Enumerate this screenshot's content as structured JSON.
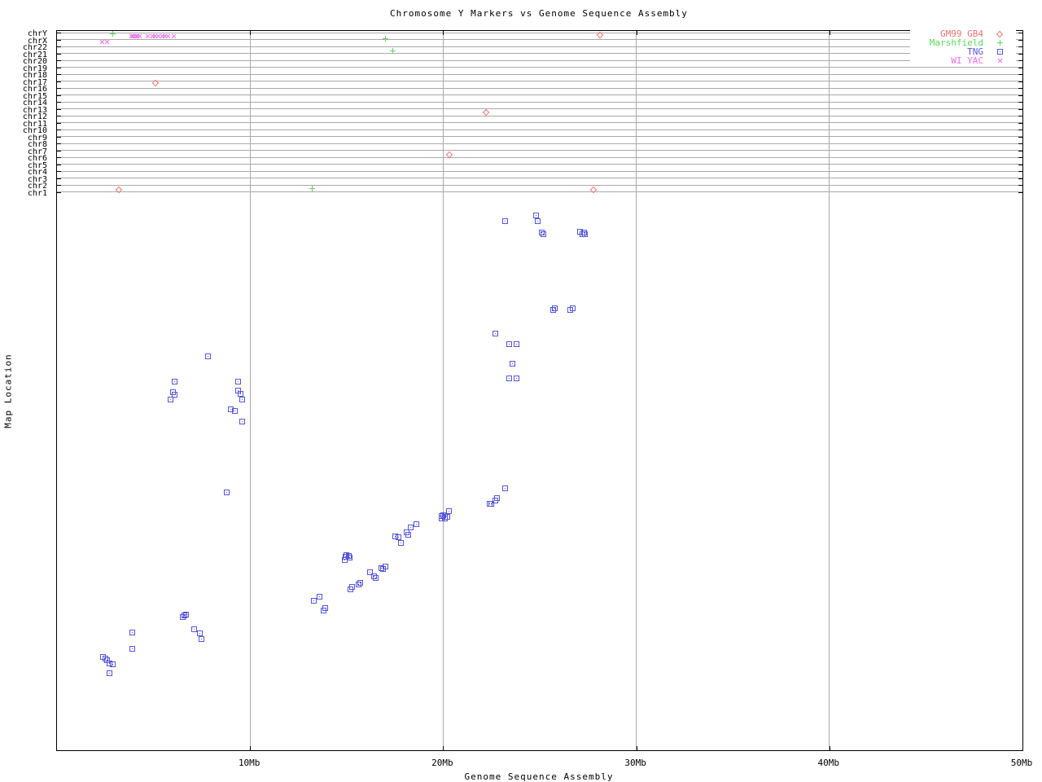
{
  "title": "Chromosome Y Markers vs Genome Sequence Assembly",
  "x_axis": {
    "label": "Genome Sequence Assembly"
  },
  "y_axis": {
    "label": "Map Location"
  },
  "legend": {
    "position": "top-right-inside"
  },
  "chart_data": {
    "type": "scatter",
    "title": "Chromosome Y Markers vs Genome Sequence Assembly",
    "xlabel": "Genome Sequence Assembly",
    "ylabel": "Map Location",
    "x_unit": "Mb",
    "xlim": [
      0,
      50
    ],
    "grid": true,
    "x_ticks": [
      {
        "mb": 10,
        "label": "10Mb"
      },
      {
        "mb": 20,
        "label": "20Mb"
      },
      {
        "mb": 30,
        "label": "30Mb"
      },
      {
        "mb": 40,
        "label": "40Mb"
      },
      {
        "mb": 50,
        "label": "50Mb"
      }
    ],
    "y_rows": [
      "chrY",
      "chrX",
      "chr22",
      "chr21",
      "chr20",
      "chr19",
      "chr18",
      "chr17",
      "chr16",
      "chr15",
      "chr14",
      "chr13",
      "chr12",
      "chr11",
      "chr10",
      "chr9",
      "chr8",
      "chr7",
      "chr6",
      "chr5",
      "chr4",
      "chr3",
      "chr2",
      "chr1"
    ],
    "y_scale_note": "Upper rows are chromosome bins; lower panel is an unlabeled continuous map-location scale. fy = fraction of plot height measured from the top border.",
    "series": [
      {
        "id": "gm99-gb4",
        "name": "GM99 GB4",
        "marker": "diamond",
        "color": "#e87272",
        "points": [
          {
            "chr": "chrY",
            "x": 28.1,
            "fy": 0.0057
          },
          {
            "chr": "chr17",
            "x": 5.1,
            "fy": 0.0725
          },
          {
            "chr": "chr13",
            "x": 22.2,
            "fy": 0.1132
          },
          {
            "chr": "chr7",
            "x": 20.3,
            "fy": 0.1721
          },
          {
            "chr": "chr2",
            "x": 3.2,
            "fy": 0.2208
          },
          {
            "chr": "chr2",
            "x": 27.8,
            "fy": 0.2208
          }
        ]
      },
      {
        "id": "marshfield",
        "name": "Marshfield",
        "marker": "plus",
        "color": "#5cd65c",
        "points": [
          {
            "chr": "chrY",
            "x": 2.9,
            "fy": 0.0045
          },
          {
            "chr": "chrX",
            "x": 17.0,
            "fy": 0.0113
          },
          {
            "chr": "chr22",
            "x": 17.4,
            "fy": 0.0272
          },
          {
            "chr": "chr2",
            "x": 13.2,
            "fy": 0.2186
          }
        ]
      },
      {
        "id": "tng",
        "name": "TNG",
        "marker": "square",
        "color": "#5656d6",
        "points": [
          [
            23.2,
            0.265
          ],
          [
            24.8,
            0.256
          ],
          [
            24.9,
            0.265
          ],
          [
            25.1,
            0.28
          ],
          [
            25.2,
            0.283
          ],
          [
            27.1,
            0.279
          ],
          [
            27.3,
            0.28
          ],
          [
            27.2,
            0.283
          ],
          [
            27.35,
            0.283
          ],
          [
            25.7,
            0.388
          ],
          [
            25.8,
            0.386
          ],
          [
            26.6,
            0.388
          ],
          [
            26.7,
            0.386
          ],
          [
            22.7,
            0.421
          ],
          [
            23.4,
            0.436
          ],
          [
            23.8,
            0.436
          ],
          [
            23.6,
            0.463
          ],
          [
            23.4,
            0.483
          ],
          [
            23.8,
            0.483
          ],
          [
            7.8,
            0.452
          ],
          [
            6.1,
            0.488
          ],
          [
            9.4,
            0.488
          ],
          [
            6.0,
            0.502
          ],
          [
            6.1,
            0.506
          ],
          [
            5.9,
            0.512
          ],
          [
            9.4,
            0.5
          ],
          [
            9.5,
            0.505
          ],
          [
            9.6,
            0.513
          ],
          [
            9.0,
            0.526
          ],
          [
            9.2,
            0.528
          ],
          [
            9.6,
            0.543
          ],
          [
            8.8,
            0.642
          ],
          [
            23.2,
            0.636
          ],
          [
            22.8,
            0.649
          ],
          [
            22.7,
            0.653
          ],
          [
            22.4,
            0.657
          ],
          [
            22.5,
            0.657
          ],
          [
            20.3,
            0.668
          ],
          [
            19.9,
            0.674
          ],
          [
            20.0,
            0.673
          ],
          [
            20.1,
            0.675
          ],
          [
            20.2,
            0.676
          ],
          [
            19.9,
            0.678
          ],
          [
            20.1,
            0.678
          ],
          [
            18.6,
            0.686
          ],
          [
            18.3,
            0.69
          ],
          [
            18.1,
            0.697
          ],
          [
            18.2,
            0.701
          ],
          [
            17.5,
            0.703
          ],
          [
            17.7,
            0.704
          ],
          [
            17.8,
            0.712
          ],
          [
            15.0,
            0.729
          ],
          [
            15.1,
            0.73
          ],
          [
            15.15,
            0.732
          ],
          [
            14.95,
            0.731
          ],
          [
            14.9,
            0.736
          ],
          [
            17.0,
            0.745
          ],
          [
            16.8,
            0.747
          ],
          [
            16.9,
            0.748
          ],
          [
            16.2,
            0.753
          ],
          [
            16.4,
            0.758
          ],
          [
            16.5,
            0.761
          ],
          [
            15.7,
            0.767
          ],
          [
            15.6,
            0.769
          ],
          [
            15.3,
            0.773
          ],
          [
            15.2,
            0.776
          ],
          [
            13.6,
            0.787
          ],
          [
            13.3,
            0.792
          ],
          [
            13.9,
            0.802
          ],
          [
            13.8,
            0.806
          ],
          [
            6.7,
            0.811
          ],
          [
            6.6,
            0.813
          ],
          [
            6.5,
            0.815
          ],
          [
            7.1,
            0.832
          ],
          [
            3.9,
            0.836
          ],
          [
            7.4,
            0.838
          ],
          [
            7.5,
            0.845
          ],
          [
            3.9,
            0.859
          ],
          [
            2.4,
            0.87
          ],
          [
            2.5,
            0.873
          ],
          [
            2.6,
            0.875
          ],
          [
            2.7,
            0.879
          ],
          [
            2.9,
            0.881
          ],
          [
            2.7,
            0.893
          ]
        ]
      },
      {
        "id": "wi-yac",
        "name": "WI YAC",
        "marker": "cross",
        "color": "#ea6fea",
        "points": [
          {
            "chr": "chrY",
            "x": 3.85,
            "fy": 0.0079
          },
          {
            "chr": "chrY",
            "x": 3.95,
            "fy": 0.0079
          },
          {
            "chr": "chrY",
            "x": 4.05,
            "fy": 0.0079
          },
          {
            "chr": "chrY",
            "x": 4.15,
            "fy": 0.0079
          },
          {
            "chr": "chrY",
            "x": 4.3,
            "fy": 0.0079
          },
          {
            "chr": "chrY",
            "x": 4.7,
            "fy": 0.0079
          },
          {
            "chr": "chrY",
            "x": 4.95,
            "fy": 0.0079
          },
          {
            "chr": "chrY",
            "x": 5.1,
            "fy": 0.0079
          },
          {
            "chr": "chrY",
            "x": 5.25,
            "fy": 0.0079
          },
          {
            "chr": "chrY",
            "x": 5.45,
            "fy": 0.0079
          },
          {
            "chr": "chrY",
            "x": 5.6,
            "fy": 0.0079
          },
          {
            "chr": "chrY",
            "x": 5.75,
            "fy": 0.0079
          },
          {
            "chr": "chrY",
            "x": 6.05,
            "fy": 0.0079
          },
          {
            "chr": "chrX",
            "x": 2.36,
            "fy": 0.0153
          },
          {
            "chr": "chrX",
            "x": 2.61,
            "fy": 0.0153
          }
        ]
      }
    ]
  }
}
